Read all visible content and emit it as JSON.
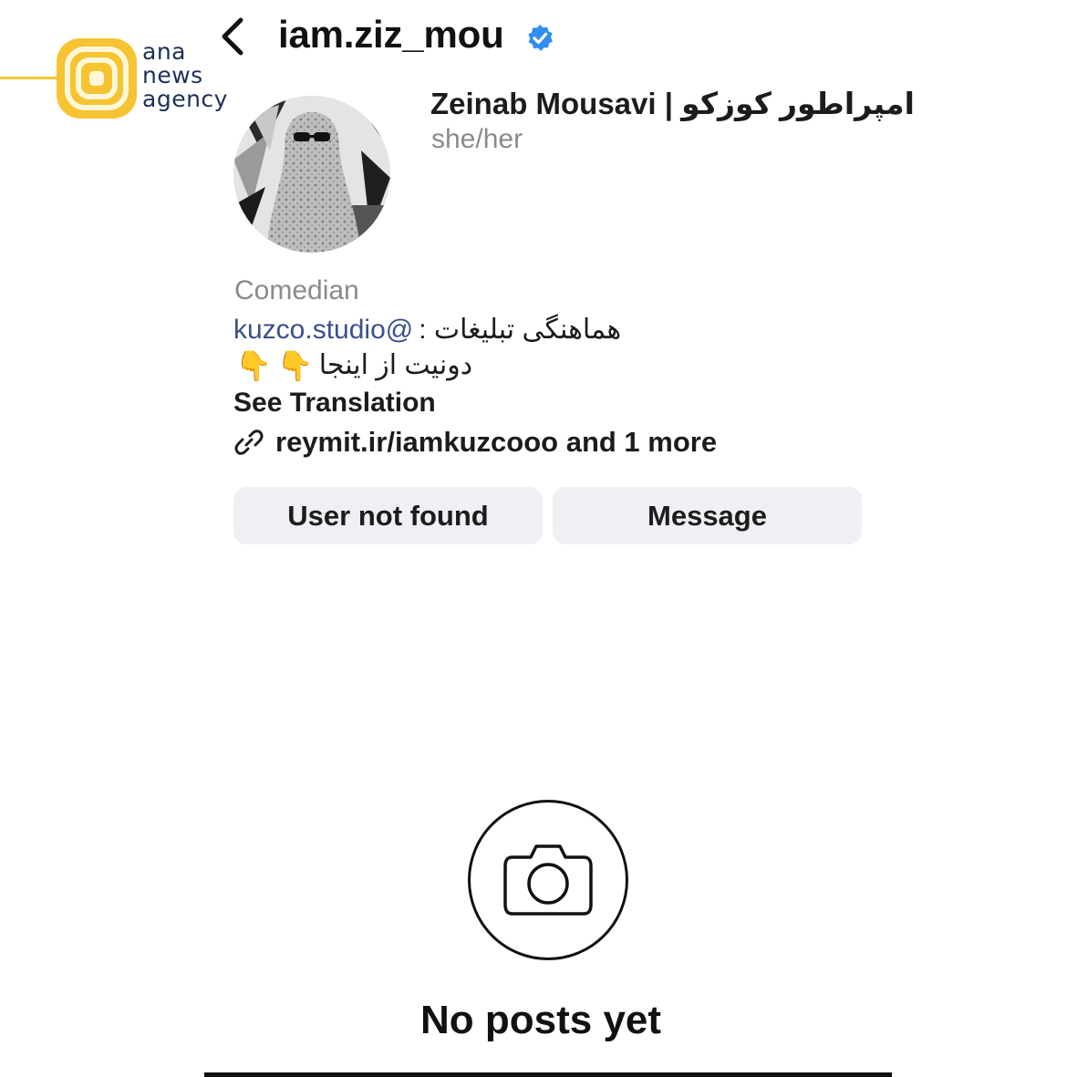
{
  "watermark": {
    "lines": [
      "ana",
      "news",
      "agency"
    ],
    "accent_color": "#f6c432",
    "text_color": "#1f2f59"
  },
  "header": {
    "back_icon": "chevron-left-icon",
    "username": "iam.ziz_mou",
    "verified_icon": "verified-badge-icon",
    "verified_color": "#2f8ef0"
  },
  "profile": {
    "display_name": "Zeinab Mousavi | امپراطور کوزکو",
    "pronouns": "she/her",
    "category": "Comedian",
    "bio": {
      "handle": "kuzco.studio@",
      "rtl_text": "هماهنگی تبلیغات :",
      "line2_text": "دونیت از اینجا",
      "finger_emoji": "👇"
    },
    "see_translation": "See Translation",
    "link_icon": "link-icon",
    "link_text": "reymit.ir/iamkuzcooo and 1 more"
  },
  "buttons": {
    "follow_label": "User not found",
    "message_label": "Message"
  },
  "empty_state": {
    "icon": "camera-icon",
    "text": "No posts yet"
  }
}
